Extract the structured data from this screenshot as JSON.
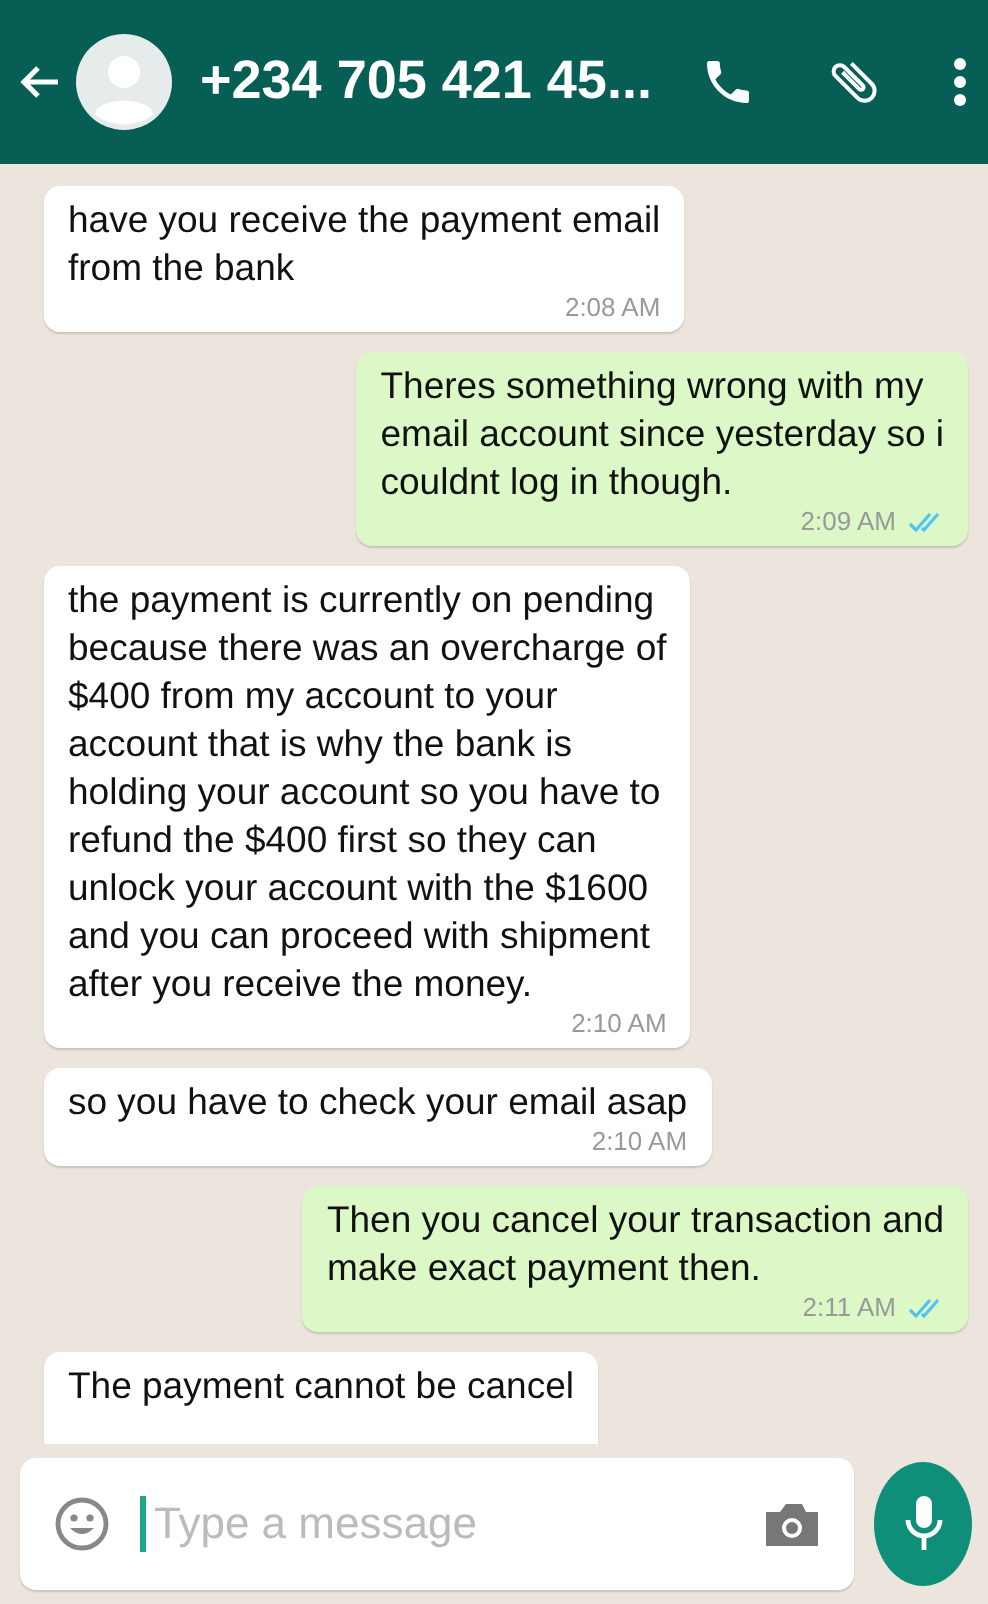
{
  "header": {
    "title": "+234 705 421 45..."
  },
  "messages": [
    {
      "kind": "incoming",
      "text": "have you receive the payment email\nfrom the bank",
      "time": "2:08 AM"
    },
    {
      "kind": "outgoing",
      "text": "Theres something wrong with my\nemail account since yesterday so i\ncouldnt log in though.",
      "time": "2:09 AM",
      "read": true
    },
    {
      "kind": "incoming",
      "text": "the payment is currently on pending\nbecause there was an overcharge of\n$400 from my account to your\naccount that is why the bank is\nholding your account so you have to\nrefund the $400 first so they can\nunlock your account with the $1600\nand you can proceed with shipment\nafter you receive the money.",
      "time": "2:10 AM"
    },
    {
      "kind": "incoming",
      "text": "so you have to check your email asap",
      "time": "2:10 AM"
    },
    {
      "kind": "outgoing",
      "text": "Then you cancel your transaction and\nmake exact payment then.",
      "time": "2:11 AM",
      "read": true
    },
    {
      "kind": "incoming",
      "text": "The payment cannot be cancel"
    }
  ],
  "composer": {
    "placeholder": "Type a message"
  }
}
